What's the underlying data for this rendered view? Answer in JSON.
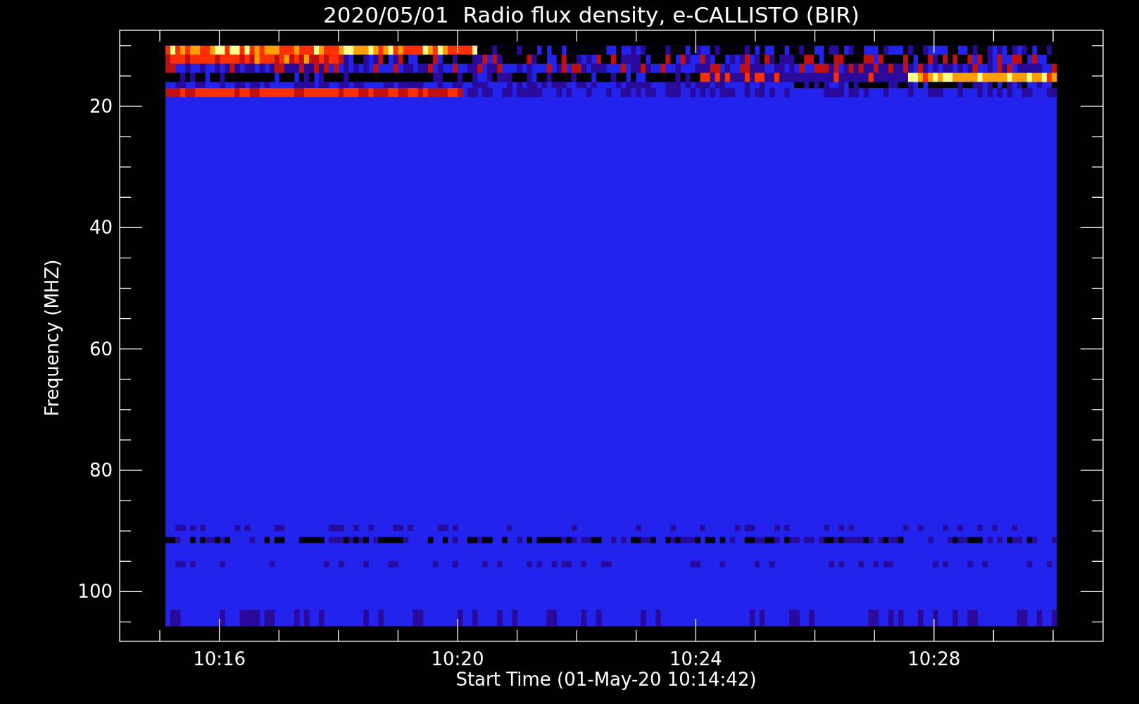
{
  "title": "2020/05/01  Radio flux density, e-CALLISTO (BIR)",
  "y_axis": {
    "label": "Frequency (MHZ)",
    "ticks": [
      "20",
      "40",
      "60",
      "80",
      "100"
    ]
  },
  "x_axis": {
    "label": "Start Time (01-May-20 10:14:42)",
    "ticks": [
      "10:16",
      "10:20",
      "10:24",
      "10:28"
    ]
  }
}
